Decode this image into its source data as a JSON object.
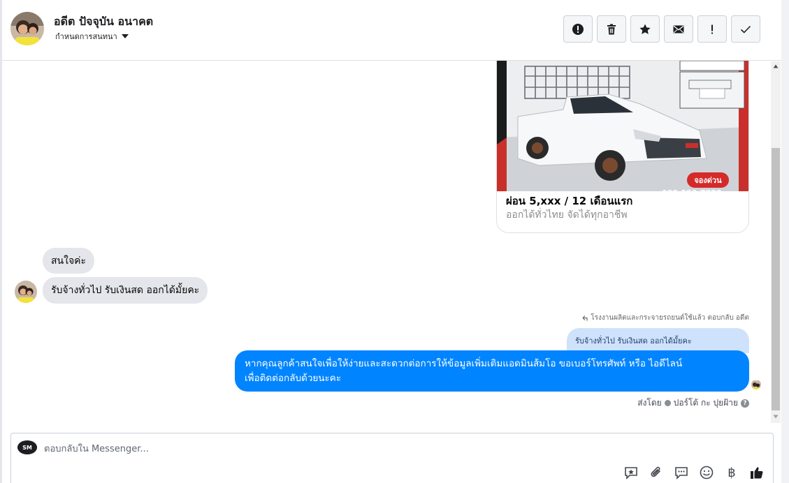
{
  "header": {
    "contact_name": "อดีต ปัจจุบัน อนาคต",
    "assign_label": "กำหนดการสนทนา",
    "actions": [
      {
        "name": "report-spam-button",
        "icon": "alert-circle-icon"
      },
      {
        "name": "delete-button",
        "icon": "trash-icon"
      },
      {
        "name": "star-button",
        "icon": "star-icon"
      },
      {
        "name": "mark-unread-button",
        "icon": "envelope-icon"
      },
      {
        "name": "follow-up-button",
        "icon": "exclamation-icon"
      },
      {
        "name": "mark-done-button",
        "icon": "checkmark-icon"
      }
    ]
  },
  "shared_post": {
    "title": "ผ่อน 5,xxx / 12 เดือนแรก",
    "subtitle": "ออกได้ทั่วไทย จัดได้ทุกอาชีพ",
    "image_badge": "จองด่วน",
    "image_phone_fragment": "088-553-7822"
  },
  "messages": {
    "incoming": [
      "สนใจค่ะ",
      "รับจ้างทั่วไป รับเงินสด ออกได้มั้ยคะ"
    ],
    "reply_context": "โรงงานผลิตและกระจายรถยนต์ใช้แล้ว ตอบกลับ อดีต",
    "quoted_text": "รับจ้างทั่วไป รับเงินสด ออกได้มั้ยคะ",
    "outgoing_lines": [
      "หากคุณลูกค้าสนใจเพื่อให้ง่ายและสะดวกต่อการให้ข้อมูลเพิ่มเติมแอดมินส้มโอ ขอเบอร์โทรศัพท์ หรือ ไอดีไลน์",
      "เพื่อติดต่อกลับด้วยนะคะ"
    ],
    "sent_by_label": "ส่งโดย",
    "sent_by_name": "ปอร์โต้ กะ ปุยฝ้าย"
  },
  "composer": {
    "placeholder": "ตอบกลับใน Messenger...",
    "logo_text": "SM",
    "baht_symbol": "฿",
    "tools": [
      "saved-reply-icon",
      "attachment-icon",
      "chat-bubble-icon",
      "emoji-icon",
      "baht-icon",
      "thumbs-up-icon"
    ]
  },
  "colors": {
    "outgoing_bubble": "#0084ff",
    "incoming_bubble": "#e4e6eb",
    "quoted_bubble": "#cfe2fb",
    "like_icon": "#1c1e21"
  }
}
